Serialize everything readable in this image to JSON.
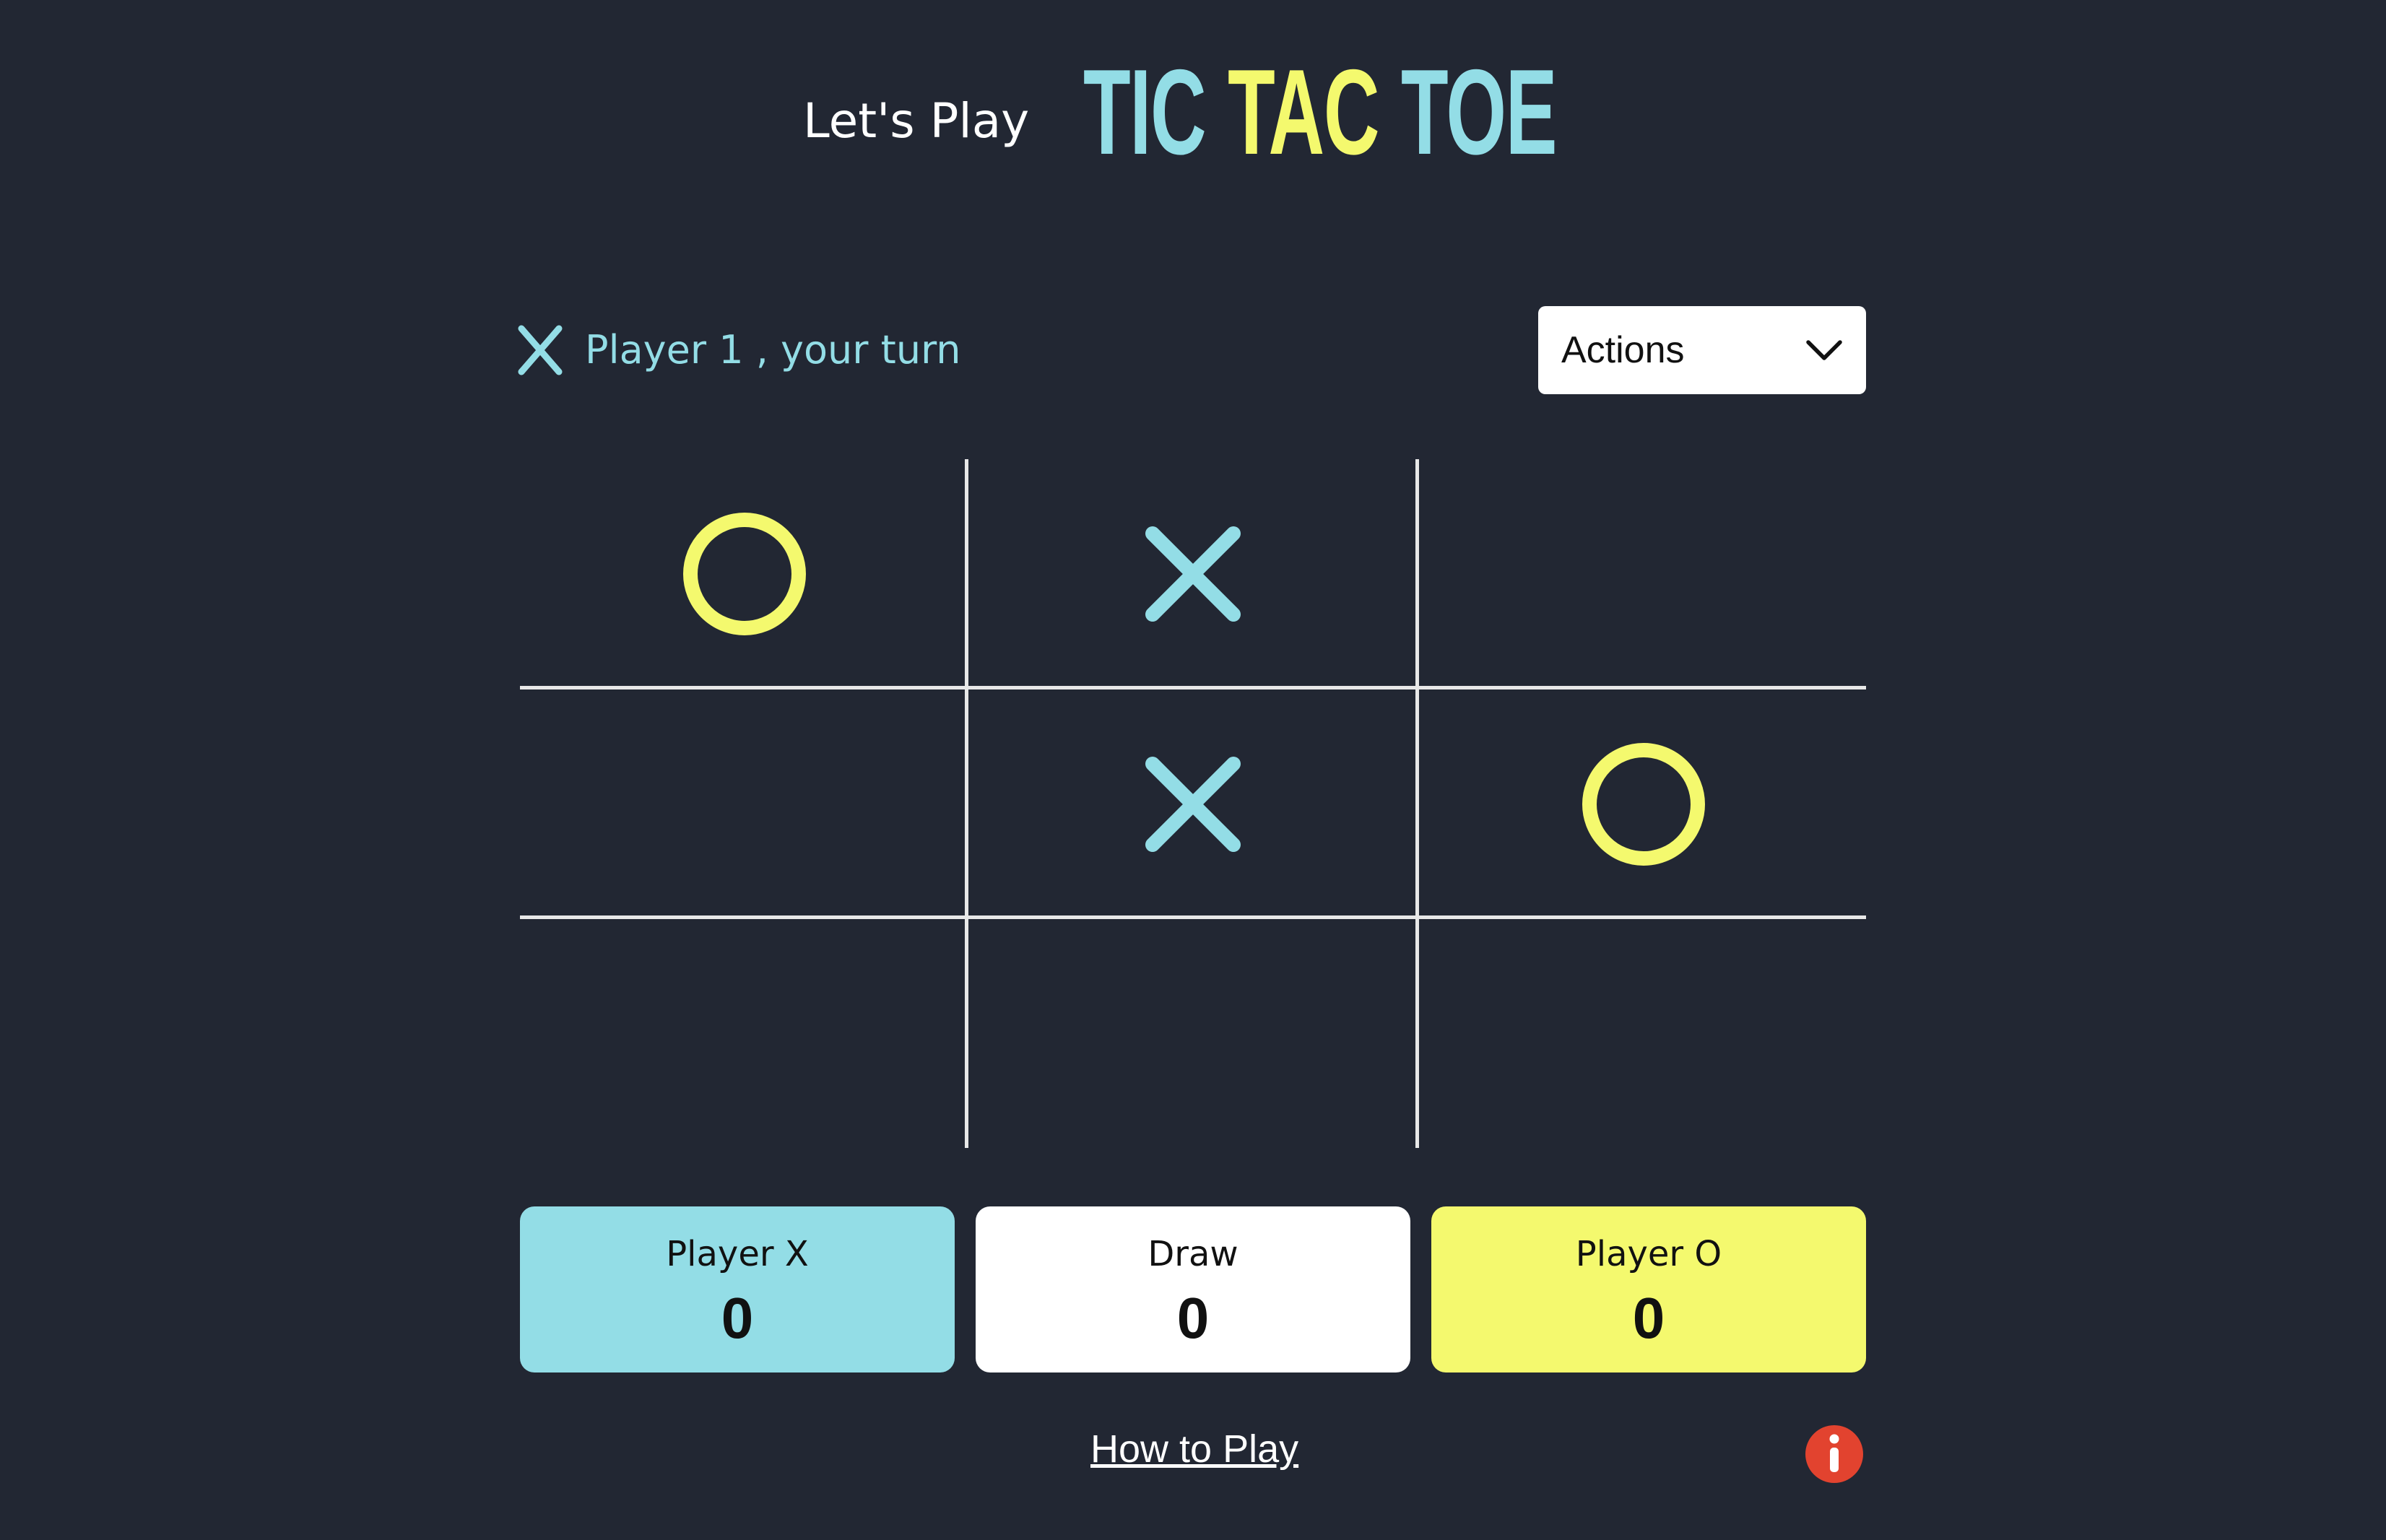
{
  "header": {
    "intro": "Let's Play",
    "logo_words": [
      "TIC",
      "TAC",
      "TOE"
    ]
  },
  "turn": {
    "icon": "x-mark-icon",
    "text": "Player 1 , your turn"
  },
  "actions": {
    "label": "Actions",
    "icon": "chevron-down-icon"
  },
  "board": {
    "cells": [
      "O",
      "X",
      "",
      "",
      "X",
      "O",
      "",
      "",
      ""
    ]
  },
  "scores": [
    {
      "label": "Player X",
      "value": "0",
      "color": "#93dde6"
    },
    {
      "label": "Draw",
      "value": "0",
      "color": "#ffffff"
    },
    {
      "label": "Player O",
      "value": "0",
      "color": "#f4f96e"
    }
  ],
  "footer": {
    "how_to_play": "How to Play",
    "info_icon": "info-icon"
  },
  "colors": {
    "background": "#222733",
    "x": "#93dde6",
    "o": "#f4f96e",
    "grid": "#e8e8e8",
    "info": "#e2432f"
  }
}
